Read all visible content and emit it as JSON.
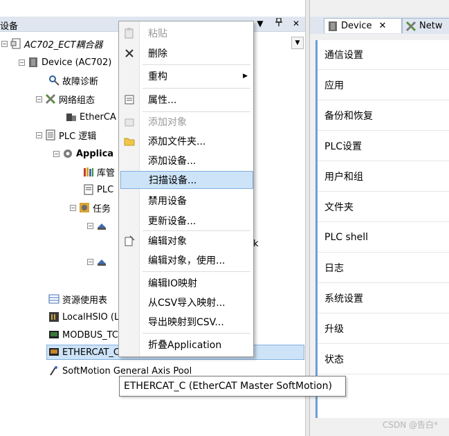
{
  "left_panel": {
    "title": "设备",
    "toolbar": {
      "dropdown": "▼",
      "pin": "ᚋ",
      "close": "✕"
    },
    "tree": [
      {
        "label": "AC702_ECT耦合器",
        "icon": "project-icon"
      },
      {
        "label": "Device (AC702)",
        "icon": "device-icon"
      },
      {
        "label": "故障诊断",
        "icon": "diagnostics-icon"
      },
      {
        "label": "网络组态",
        "icon": "network-config-icon"
      },
      {
        "label": "EtherCA",
        "icon": "ethercat-device-icon"
      },
      {
        "label": "PLC 逻辑",
        "icon": "plc-logic-icon"
      },
      {
        "label": "Applica",
        "icon": "application-gear-icon"
      },
      {
        "label": "库管",
        "icon": "library-icon"
      },
      {
        "label": "PLC",
        "icon": "plc-program-icon"
      },
      {
        "label": "任务",
        "icon": "task-config-icon"
      },
      {
        "label": "",
        "icon": "task-icon"
      },
      {
        "label": "k",
        "icon": ""
      },
      {
        "label": "",
        "icon": "task-icon"
      },
      {
        "label": "资源使用表",
        "icon": "resource-table-icon"
      },
      {
        "label": "LocalHSIO (L",
        "icon": "hsio-icon"
      },
      {
        "label": "MODBUS_TC",
        "icon": "modbus-icon"
      },
      {
        "label": "ETHERCAT_C",
        "icon": "ethercat-master-icon"
      },
      {
        "label": "SoftMotion General Axis Pool",
        "icon": "axis-pool-icon"
      }
    ]
  },
  "right_panel": {
    "tabs": [
      {
        "label": "Device",
        "close": "✕",
        "icon": "device-tab-icon"
      },
      {
        "label": "Netw",
        "icon": "network-tab-icon"
      }
    ],
    "settings": [
      "通信设置",
      "应用",
      "备份和恢复",
      "PLC设置",
      "用户和组",
      "文件夹",
      "PLC shell",
      "日志",
      "系统设置",
      "升级",
      "状态"
    ]
  },
  "context_menu": {
    "items": [
      {
        "label": "粘贴",
        "icon": "paste-icon",
        "disabled": true
      },
      {
        "label": "删除",
        "icon": "delete-icon"
      },
      {
        "label": "重构",
        "submenu": "▶"
      },
      {
        "label": "属性...",
        "icon": "properties-icon"
      },
      {
        "label": "添加对象",
        "icon": "add-object-icon",
        "disabled": true
      },
      {
        "label": "添加文件夹...",
        "icon": "folder-icon"
      },
      {
        "label": "添加设备..."
      },
      {
        "label": "扫描设备..."
      },
      {
        "label": "禁用设备"
      },
      {
        "label": "更新设备..."
      },
      {
        "label": "编辑对象",
        "icon": "edit-object-icon"
      },
      {
        "label": "编辑对象，使用..."
      },
      {
        "label": "编辑IO映射"
      },
      {
        "label": "从CSV导入映射..."
      },
      {
        "label": "导出映射到CSV..."
      },
      {
        "label": "折叠Application"
      }
    ]
  },
  "tooltip": {
    "text": "ETHERCAT_C (EtherCAT Master SoftMotion)"
  },
  "watermark": "CSDN @告白*",
  "colors": {
    "accent": "#6b9ed8",
    "highlight": "#cde3f7",
    "highlight_border": "#7fb0df",
    "title_bar": "#dfe6f0"
  }
}
